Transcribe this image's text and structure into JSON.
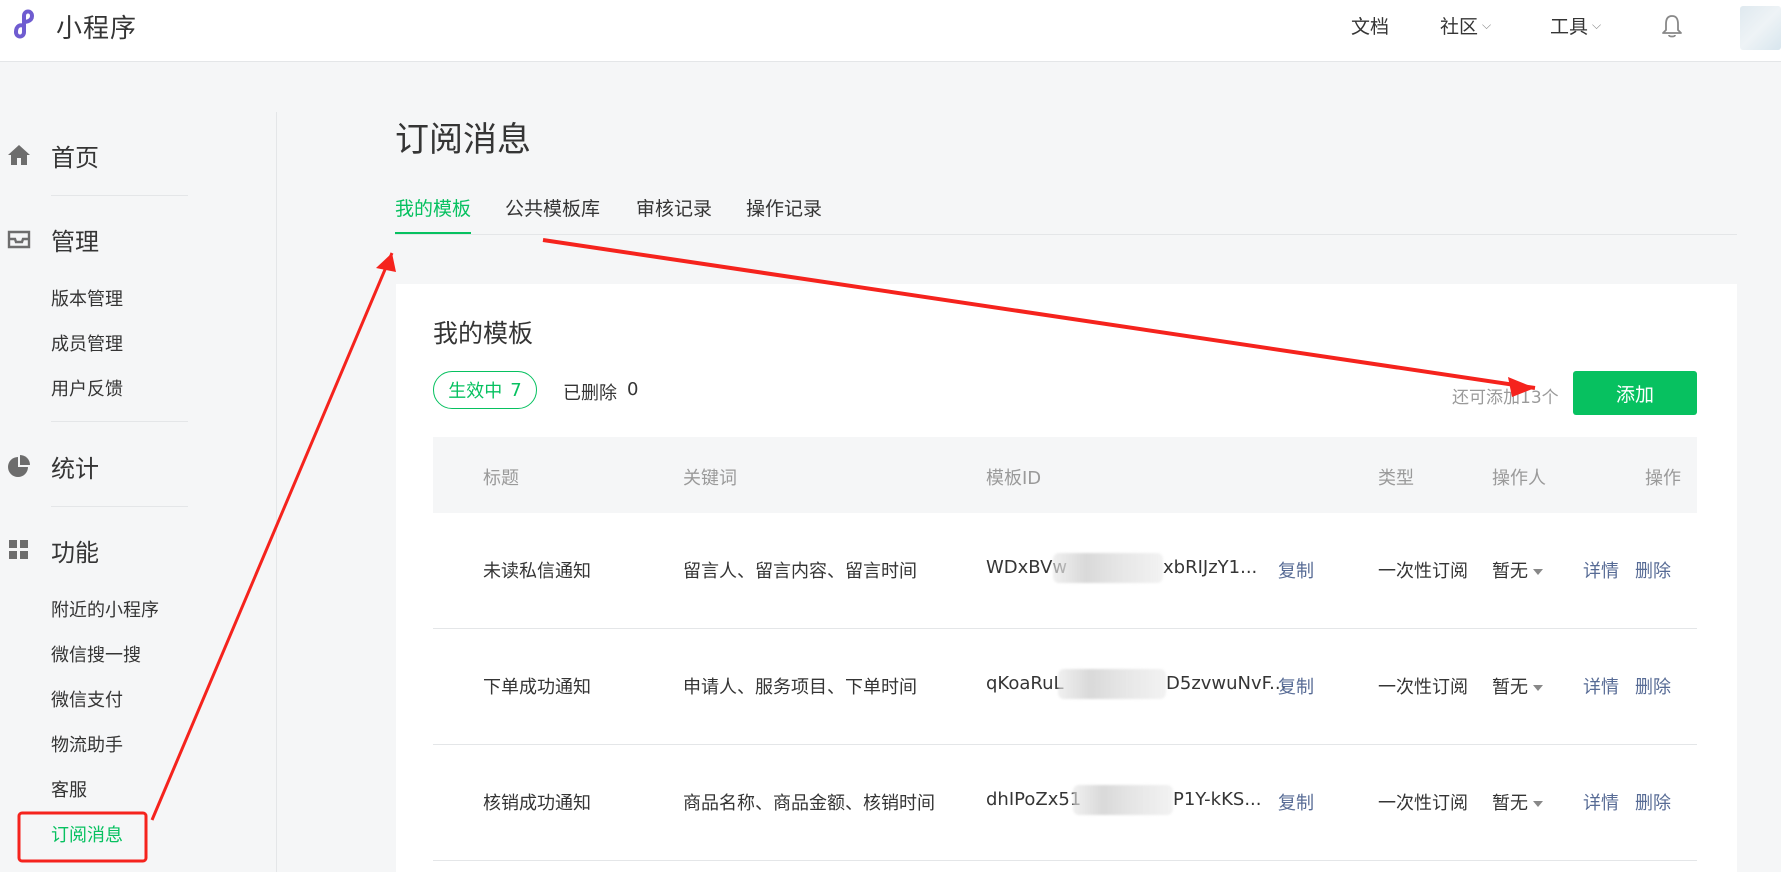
{
  "app": {
    "brand": "小程序",
    "top_nav": [
      {
        "label": "文档",
        "has_dropdown": false
      },
      {
        "label": "社区",
        "has_dropdown": true
      },
      {
        "label": "工具",
        "has_dropdown": true
      }
    ],
    "brand_color": "#07c160",
    "logo_color": "#6f5cd0",
    "link_color": "#576b95"
  },
  "sidebar": {
    "home": {
      "label": "首页",
      "icon": "home-icon"
    },
    "manage": {
      "label": "管理",
      "icon": "inbox-icon",
      "items": [
        "版本管理",
        "成员管理",
        "用户反馈"
      ]
    },
    "stats": {
      "label": "统计",
      "icon": "pie-chart-icon"
    },
    "features": {
      "label": "功能",
      "icon": "grid-icon",
      "items": [
        "附近的小程序",
        "微信搜一搜",
        "微信支付",
        "物流助手",
        "客服",
        "订阅消息"
      ],
      "active_item": "订阅消息"
    }
  },
  "main": {
    "title": "订阅消息",
    "tabs": [
      "我的模板",
      "公共模板库",
      "审核记录",
      "操作记录"
    ],
    "active_tab": "我的模板",
    "card": {
      "title": "我的模板",
      "active_filter": {
        "label": "生效中",
        "count": "7"
      },
      "deleted_filter": {
        "label": "已删除",
        "count": "0"
      },
      "quota_text": "还可添加13个",
      "add_label": "添加",
      "columns": [
        "标题",
        "关键词",
        "模板ID",
        "类型",
        "操作人",
        "操作"
      ],
      "rows": [
        {
          "title": "未读私信通知",
          "keywords": "留言人、留言内容、留言时间",
          "id_prefix": "WDxBVw",
          "id_suffix": "xbRIJzY1...",
          "copy": "复制",
          "type": "一次性订阅",
          "operator": "暂无",
          "detail": "详情",
          "delete": "删除"
        },
        {
          "title": "下单成功通知",
          "keywords": "申请人、服务项目、下单时间",
          "id_prefix": "qKoaRuL",
          "id_suffix": "D5zvwuNvF...",
          "copy": "复制",
          "type": "一次性订阅",
          "operator": "暂无",
          "detail": "详情",
          "delete": "删除"
        },
        {
          "title": "核销成功通知",
          "keywords": "商品名称、商品金额、核销时间",
          "id_prefix": "dhIPoZx51",
          "id_suffix": "P1Y-kKS...",
          "copy": "复制",
          "type": "一次性订阅",
          "operator": "暂无",
          "detail": "详情",
          "delete": "删除"
        }
      ]
    }
  },
  "annotation_color": "#f5231d"
}
